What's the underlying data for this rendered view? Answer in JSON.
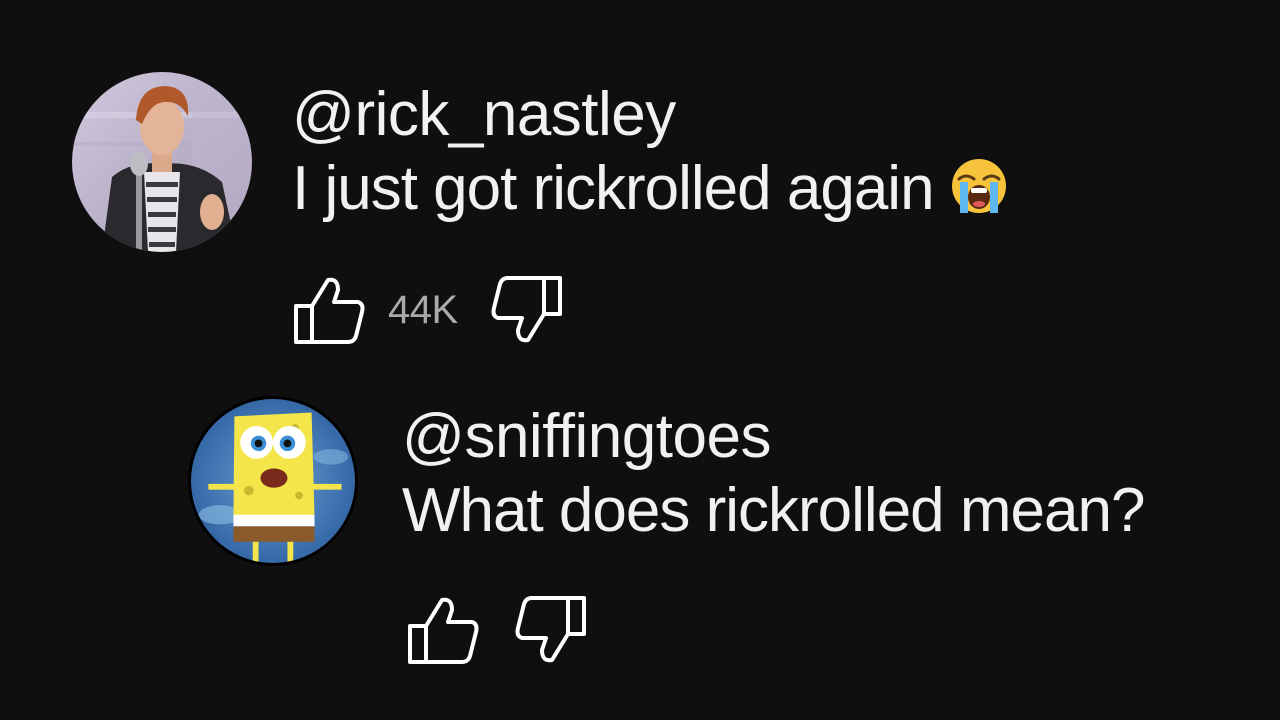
{
  "comments": [
    {
      "handle": "@rick_nastley",
      "text": "I just got rickrolled again",
      "emoji": "loudly-crying-face",
      "likes": "44K"
    },
    {
      "handle": "@sniffingtoes",
      "text": "What does rickrolled mean?",
      "likes": ""
    }
  ],
  "colors": {
    "background": "#0f0f0f",
    "text": "#f1f1f1",
    "secondary_text": "#aaaaaa"
  }
}
